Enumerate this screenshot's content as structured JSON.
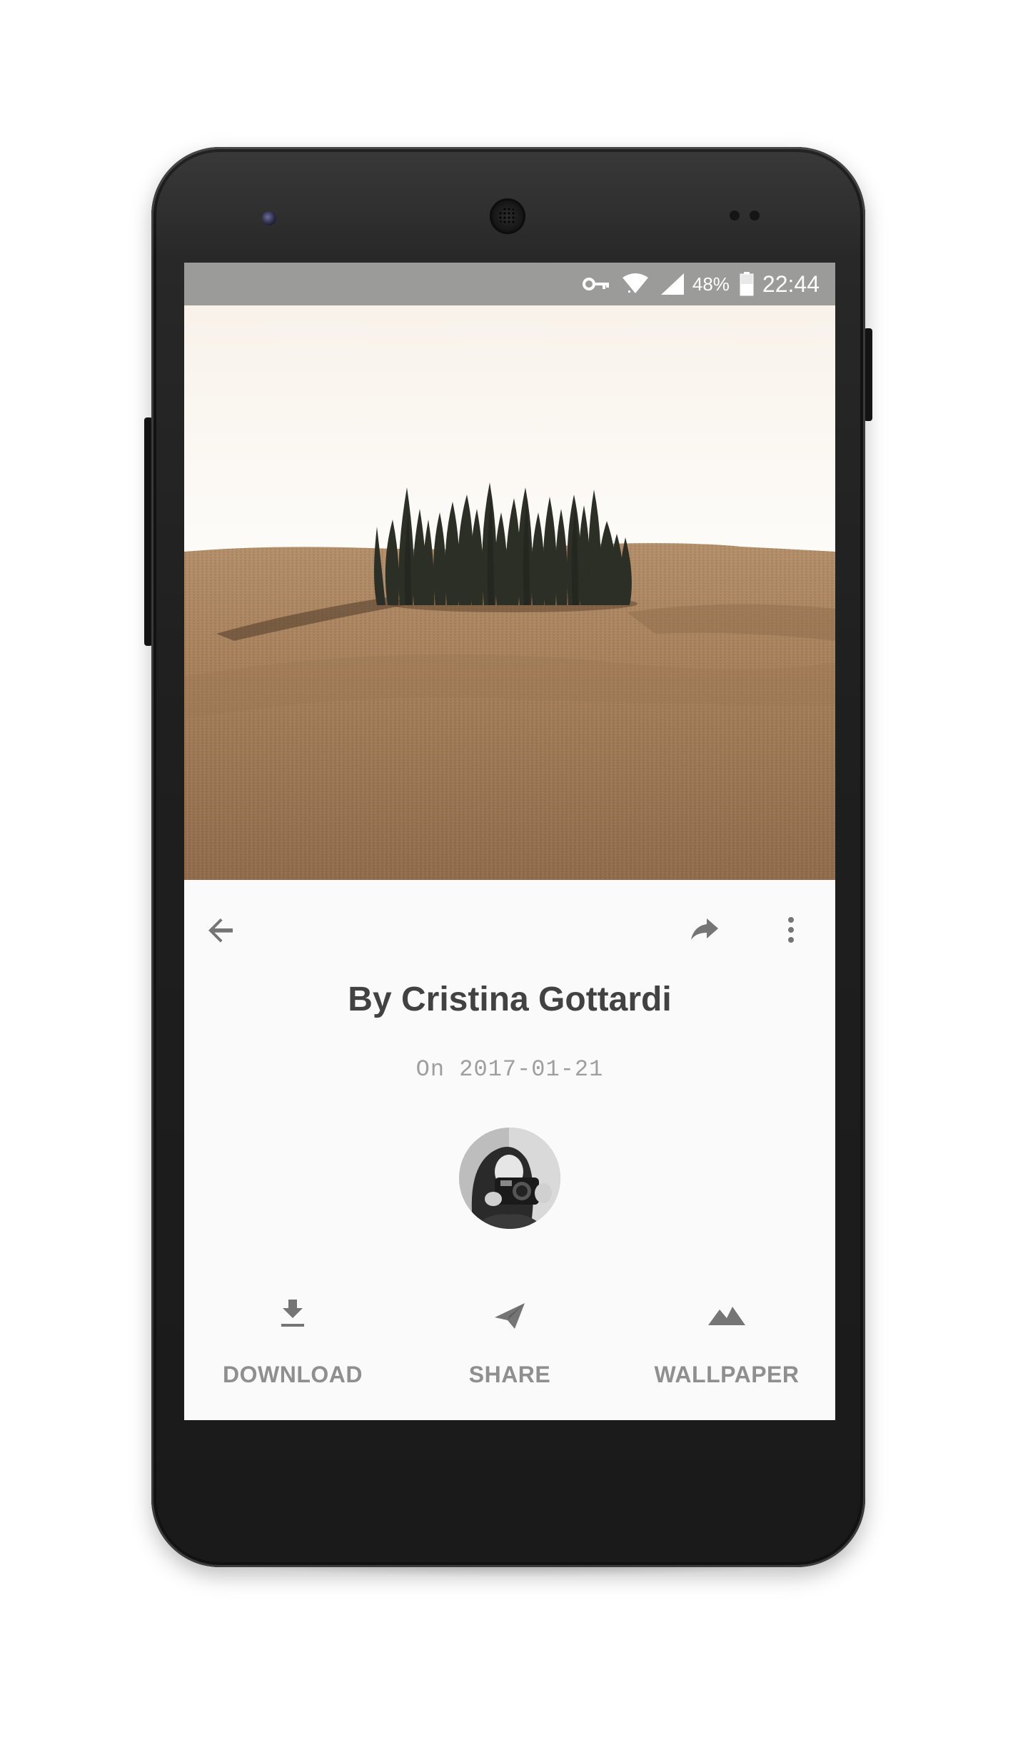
{
  "status_bar": {
    "icons": [
      "vpn-key-icon",
      "wifi-icon",
      "cell-signal-icon",
      "battery-icon"
    ],
    "battery_percent": "48%",
    "time": "22:44"
  },
  "photo": {
    "subject": "cypress-trees-on-hill",
    "colors": {
      "sky": "#fbf8f3",
      "field": "#a7815c",
      "trees": "#2b2f26"
    }
  },
  "toolbar": {
    "icons": [
      "arrow-back-icon",
      "share-forward-icon",
      "more-vert-icon"
    ]
  },
  "details": {
    "author_title": "By Cristina Gottardi",
    "date_text": "On 2017-01-21"
  },
  "actions": [
    {
      "label": "DOWNLOAD",
      "icon": "download-icon"
    },
    {
      "label": "SHARE",
      "icon": "send-icon"
    },
    {
      "label": "WALLPAPER",
      "icon": "landscape-icon"
    }
  ],
  "colors": {
    "status_bar_bg": "#9b9b9a",
    "screen_bg": "#fafafa",
    "title_text": "#424242",
    "secondary_text": "#9e9e9e",
    "icon_gray": "#757575",
    "phone_body": "#1f1f1f"
  }
}
